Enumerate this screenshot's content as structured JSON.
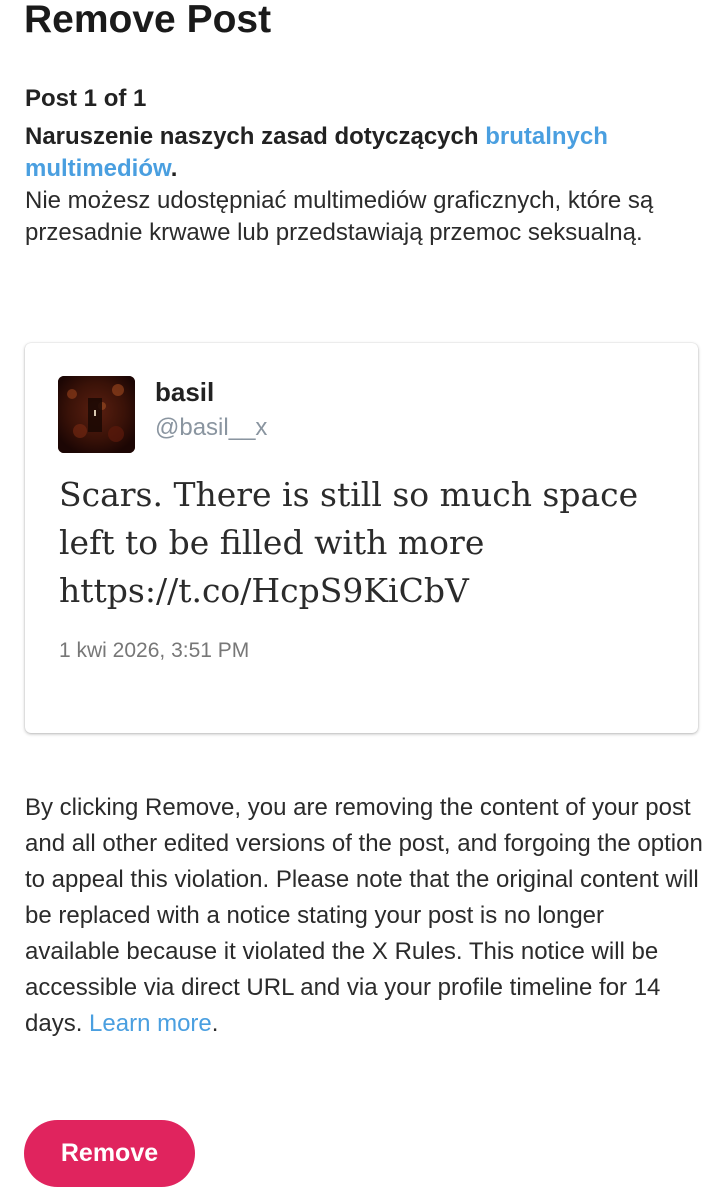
{
  "page": {
    "title": "Remove Post",
    "post_counter": "Post 1 of 1"
  },
  "violation": {
    "heading_prefix": "Naruszenie naszych zasad dotyczących ",
    "policy_link": "brutalnych multimediów",
    "heading_suffix": ".",
    "description": "Nie możesz udostępniać multimediów graficznych, które są przesadnie krwawe lub przedstawiają przemoc seksualną."
  },
  "post": {
    "author_name": "basil",
    "author_handle": "@basil__x",
    "text": "Scars. There is still so much space\nleft to be filled with more\nhttps://t.co/HcpS9KiCbV",
    "timestamp": "1 kwi 2026, 3:51 PM",
    "avatar_icon": "profile-avatar-dark-red"
  },
  "notice": {
    "text": "By clicking Remove, you are removing the content of your post and all other edited versions of the post, and forgoing the option to appeal this violation. Please note that the original content will be replaced with a notice stating your post is no longer available because it violated the X Rules. This notice will be accessible via direct URL and via your profile timeline for 14 days. ",
    "learn_more": "Learn more",
    "suffix": "."
  },
  "actions": {
    "remove_label": "Remove"
  },
  "colors": {
    "accent_link": "#4a9fe0",
    "remove_button": "#e0245e",
    "handle_gray": "#8a95a0"
  }
}
